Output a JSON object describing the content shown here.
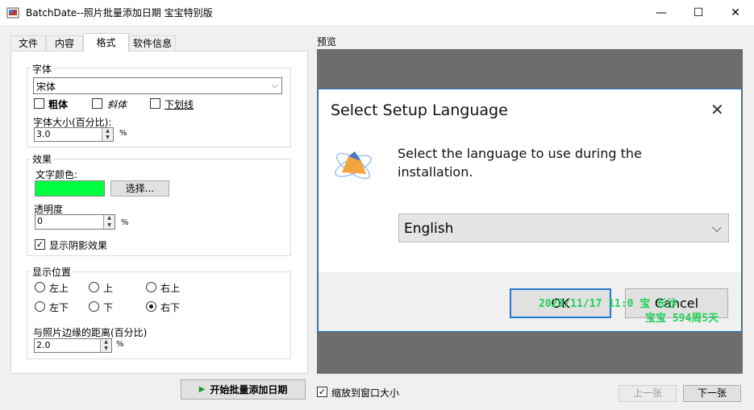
{
  "window": {
    "title": "BatchDate--照片批量添加日期 宝宝特别版",
    "controls": {
      "minimize": "—",
      "maximize": "☐",
      "close": "✕"
    }
  },
  "tabs": [
    {
      "label": "文件"
    },
    {
      "label": "内容"
    },
    {
      "label": "格式"
    },
    {
      "label": "软件信息"
    }
  ],
  "font_group": {
    "label": "字体",
    "font_value": "宋体",
    "bold_label": "粗体",
    "italic_label": "斜体",
    "underline_label": "下划线",
    "size_label": "字体大小(百分比):",
    "size_value": "3.0",
    "size_unit": "%"
  },
  "effect_group": {
    "label": "效果",
    "color_label": "文字颜色:",
    "color": "#00ff40",
    "choose_button": "选择...",
    "opacity_label": "透明度",
    "opacity_value": "0",
    "opacity_unit": "%",
    "shadow_label": "显示阴影效果",
    "shadow_checked": true
  },
  "position_group": {
    "label": "显示位置",
    "options": [
      "左上",
      "上",
      "右上",
      "左下",
      "下",
      "右下"
    ],
    "selected": "右下",
    "distance_label": "与照片边缘的距离(百分比)",
    "distance_value": "2.0",
    "distance_unit": "%"
  },
  "start_button": "开始批量添加日期",
  "preview": {
    "label": "预览",
    "fit_label": "缩放到窗口大小",
    "fit_checked": true,
    "prev_button": "上一张",
    "next_button": "下一张",
    "dialog": {
      "title": "Select Setup Language",
      "message_line1": "Select the language to use during the",
      "message_line2": "installation.",
      "language": "English",
      "ok": "OK",
      "cancel": "Cancel"
    },
    "stamp_line1": "2020/11/17 11:0 宝 长沙",
    "stamp_line2": "宝宝 594周5天",
    "stamp_color": "#22d05a"
  }
}
